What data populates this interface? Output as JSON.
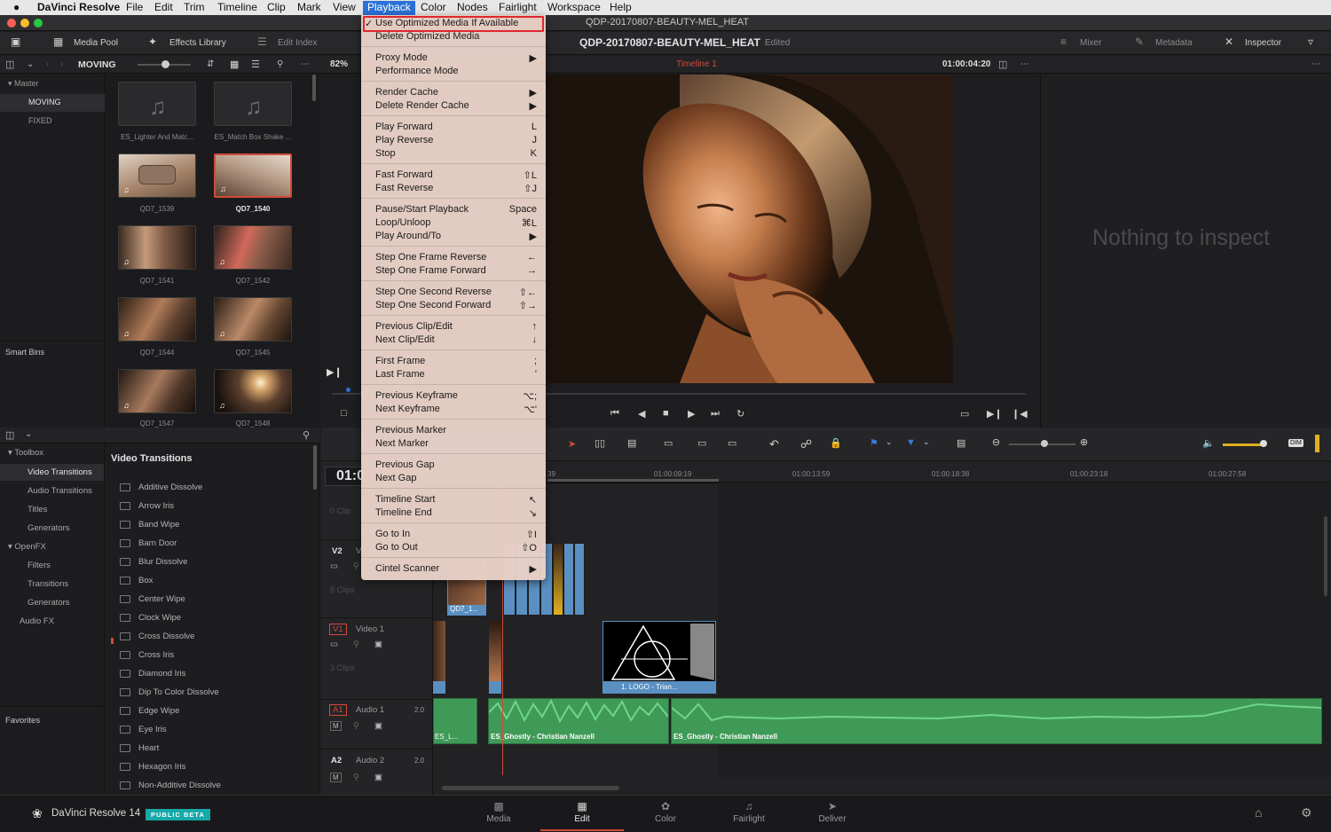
{
  "menubar": {
    "apple": "",
    "app": "DaVinci Resolve",
    "items": [
      "File",
      "Edit",
      "Trim",
      "Timeline",
      "Clip",
      "Mark",
      "View",
      "Playback",
      "Color",
      "Nodes",
      "Fairlight",
      "Workspace",
      "Help"
    ]
  },
  "window": {
    "title": "QDP-20170807-BEAUTY-MEL_HEAT"
  },
  "toolbar": {
    "media_pool": "Media Pool",
    "effects_library": "Effects Library",
    "edit_index": "Edit Index",
    "project": "QDP-20170807-BEAUTY-MEL_HEAT",
    "status": "Edited",
    "mixer": "Mixer",
    "metadata": "Metadata",
    "inspector": "Inspector"
  },
  "subbar": {
    "bin": "MOVING",
    "zoom": "82%",
    "timeline": "Timeline 1",
    "timecode": "01:00:04:20"
  },
  "bins": {
    "master": "Master",
    "items": [
      "MOVING",
      "FIXED"
    ],
    "smart": "Smart Bins",
    "favorites": "Favorites"
  },
  "clips": [
    "ES_Lighter And Matc...",
    "ES_Match Box Shake ...",
    "QD7_1539",
    "QD7_1540",
    "QD7_1541",
    "QD7_1542",
    "QD7_1544",
    "QD7_1545",
    "QD7_1547",
    "QD7_1548"
  ],
  "inspector": {
    "empty": "Nothing to inspect"
  },
  "effects": {
    "toolbox": "Toolbox",
    "video_transitions": "Video Transitions",
    "audio_transitions": "Audio Transitions",
    "titles": "Titles",
    "generators": "Generators",
    "openfx": "OpenFX",
    "filters": "Filters",
    "transitions": "Transitions",
    "generators2": "Generators",
    "audiofx": "Audio FX",
    "heading": "Video Transitions",
    "items": [
      "Additive Dissolve",
      "Arrow Iris",
      "Band Wipe",
      "Barn Door",
      "Blur Dissolve",
      "Box",
      "Center Wipe",
      "Clock Wipe",
      "Cross Dissolve",
      "Cross Iris",
      "Diamond Iris",
      "Dip To Color Dissolve",
      "Edge Wipe",
      "Eye Iris",
      "Heart",
      "Hexagon Iris",
      "Non-Additive Dissolve"
    ]
  },
  "timeline": {
    "tc": "01:0",
    "ruler": [
      "39",
      "01:00:09:19",
      "01:00:13:59",
      "01:00:18:38",
      "01:00:23:18",
      "01:00:27:58"
    ],
    "tracks": [
      {
        "id": "V2",
        "name": "V",
        "count": "8 Clips"
      },
      {
        "id": "V1",
        "name": "Video 1",
        "count": "3 Clips"
      },
      {
        "id": "A1",
        "name": "Audio 1",
        "level": "2.0"
      },
      {
        "id": "A2",
        "name": "Audio 2",
        "level": "2.0"
      }
    ],
    "zero_clip": "0 Clip",
    "clip_v2": "QD7_1...",
    "clip_logo": "1. LOGO - Trian...",
    "audio_clips": [
      "ES_L...",
      "ES_Ghostly - Christian Nanzell",
      "ES_Ghostly - Christian Nanzell"
    ],
    "dim": "DIM"
  },
  "pages": [
    "Media",
    "Edit",
    "Color",
    "Fairlight",
    "Deliver"
  ],
  "brand": {
    "name": "DaVinci Resolve 14",
    "badge": "PUBLIC BETA"
  },
  "playback_menu": [
    {
      "label": "Use Optimized Media If Available",
      "key": "",
      "check": "✓"
    },
    {
      "label": "Delete Optimized Media",
      "key": ""
    },
    {
      "label": "Proxy Mode",
      "key": "▶"
    },
    {
      "label": "Performance Mode",
      "key": ""
    },
    {
      "label": "Render Cache",
      "key": "▶"
    },
    {
      "label": "Delete Render Cache",
      "key": "▶"
    },
    {
      "label": "Play Forward",
      "key": "L"
    },
    {
      "label": "Play Reverse",
      "key": "J"
    },
    {
      "label": "Stop",
      "key": "K"
    },
    {
      "label": "Fast Forward",
      "key": "⇧L"
    },
    {
      "label": "Fast Reverse",
      "key": "⇧J"
    },
    {
      "label": "Pause/Start Playback",
      "key": "Space"
    },
    {
      "label": "Loop/Unloop",
      "key": "⌘L"
    },
    {
      "label": "Play Around/To",
      "key": "▶"
    },
    {
      "label": "Step One Frame Reverse",
      "key": "←"
    },
    {
      "label": "Step One Frame Forward",
      "key": "→"
    },
    {
      "label": "Step One Second Reverse",
      "key": "⇧←"
    },
    {
      "label": "Step One Second Forward",
      "key": "⇧→"
    },
    {
      "label": "Previous Clip/Edit",
      "key": "↑"
    },
    {
      "label": "Next Clip/Edit",
      "key": "↓"
    },
    {
      "label": "First Frame",
      "key": ";"
    },
    {
      "label": "Last Frame",
      "key": "'"
    },
    {
      "label": "Previous Keyframe",
      "key": "⌥;"
    },
    {
      "label": "Next Keyframe",
      "key": "⌥'"
    },
    {
      "label": "Previous Marker",
      "key": ""
    },
    {
      "label": "Next Marker",
      "key": ""
    },
    {
      "label": "Previous Gap",
      "key": ""
    },
    {
      "label": "Next Gap",
      "key": ""
    },
    {
      "label": "Timeline Start",
      "key": "↖"
    },
    {
      "label": "Timeline End",
      "key": "↘"
    },
    {
      "label": "Go to In",
      "key": "⇧I"
    },
    {
      "label": "Go to Out",
      "key": "⇧O"
    },
    {
      "label": "Cintel Scanner",
      "key": "▶"
    }
  ],
  "colors": {
    "accent_red": "#d14a3a",
    "menu_highlight": "#2a71d8",
    "audio_green": "#3f9a58",
    "video_blue": "#5a8fc2"
  }
}
